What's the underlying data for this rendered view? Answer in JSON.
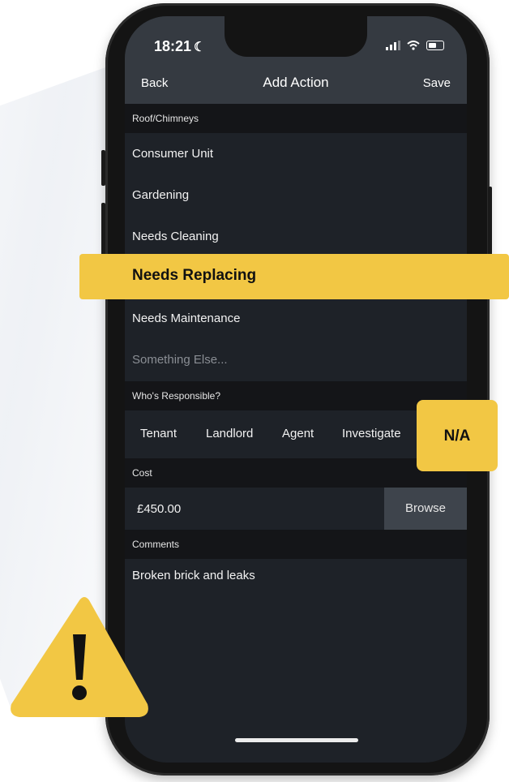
{
  "status_bar": {
    "time": "18:21",
    "moon": "☾"
  },
  "nav": {
    "back_label": "Back",
    "title": "Add Action",
    "save_label": "Save"
  },
  "category": {
    "header": "Roof/Chimneys",
    "items": [
      {
        "label": "Consumer Unit"
      },
      {
        "label": "Gardening"
      },
      {
        "label": "Needs Cleaning"
      },
      {
        "label": "Needs Replacing"
      },
      {
        "label": "Needs Maintenance"
      }
    ],
    "other_placeholder": "Something Else...",
    "selected": "Needs Replacing"
  },
  "responsible": {
    "header": "Who's Responsible?",
    "options": [
      "Tenant",
      "Landlord",
      "Agent",
      "Investigate",
      "N/A"
    ],
    "selected": "N/A"
  },
  "cost": {
    "header": "Cost",
    "value": "£450.00",
    "browse_label": "Browse"
  },
  "comments": {
    "header": "Comments",
    "value": "Broken brick and leaks"
  },
  "colors": {
    "accent_yellow": "#f2c744",
    "screen_bg": "#1e2228",
    "section_header_bg": "#141518",
    "navbar_bg": "#353a41"
  },
  "icons": {
    "warning": "warning-triangle-icon",
    "signal": "signal-icon",
    "wifi": "wifi-icon",
    "battery": "battery-icon"
  }
}
